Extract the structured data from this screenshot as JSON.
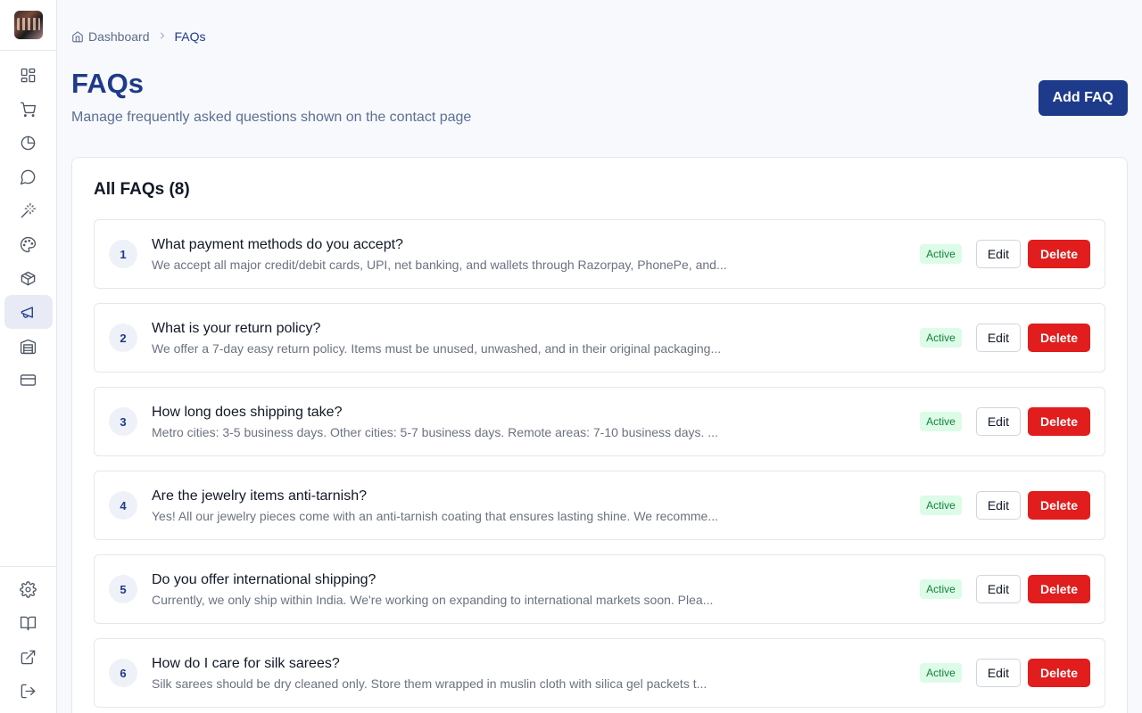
{
  "sidebar": {
    "logo": "brand-logo",
    "nav": [
      {
        "icon": "dashboard-icon"
      },
      {
        "icon": "cart-icon"
      },
      {
        "icon": "pie-chart-icon"
      },
      {
        "icon": "message-icon"
      },
      {
        "icon": "magic-wand-icon"
      },
      {
        "icon": "palette-icon"
      },
      {
        "icon": "package-icon"
      },
      {
        "icon": "megaphone-icon",
        "active": true
      },
      {
        "icon": "warehouse-icon"
      },
      {
        "icon": "credit-card-icon"
      }
    ],
    "bottom": [
      {
        "icon": "settings-icon"
      },
      {
        "icon": "book-icon"
      },
      {
        "icon": "external-link-icon"
      },
      {
        "icon": "logout-icon"
      }
    ]
  },
  "breadcrumb": {
    "home": "Dashboard",
    "current": "FAQs"
  },
  "header": {
    "title": "FAQs",
    "subtitle": "Manage frequently asked questions shown on the contact page",
    "add_button": "Add FAQ"
  },
  "list": {
    "title": "All FAQs (8)",
    "items": [
      {
        "num": "1",
        "question": "What payment methods do you accept?",
        "answer": "We accept all major credit/debit cards, UPI, net banking, and wallets through Razorpay, PhonePe, and...",
        "status": "Active",
        "edit": "Edit",
        "delete": "Delete"
      },
      {
        "num": "2",
        "question": "What is your return policy?",
        "answer": "We offer a 7-day easy return policy. Items must be unused, unwashed, and in their original packaging...",
        "status": "Active",
        "edit": "Edit",
        "delete": "Delete"
      },
      {
        "num": "3",
        "question": "How long does shipping take?",
        "answer": "Metro cities: 3-5 business days. Other cities: 5-7 business days. Remote areas: 7-10 business days. ...",
        "status": "Active",
        "edit": "Edit",
        "delete": "Delete"
      },
      {
        "num": "4",
        "question": "Are the jewelry items anti-tarnish?",
        "answer": "Yes! All our jewelry pieces come with an anti-tarnish coating that ensures lasting shine. We recomme...",
        "status": "Active",
        "edit": "Edit",
        "delete": "Delete"
      },
      {
        "num": "5",
        "question": "Do you offer international shipping?",
        "answer": "Currently, we only ship within India. We're working on expanding to international markets soon. Plea...",
        "status": "Active",
        "edit": "Edit",
        "delete": "Delete"
      },
      {
        "num": "6",
        "question": "How do I care for silk sarees?",
        "answer": "Silk sarees should be dry cleaned only. Store them wrapped in muslin cloth with silica gel packets t...",
        "status": "Active",
        "edit": "Edit",
        "delete": "Delete"
      }
    ]
  },
  "colors": {
    "primary": "#1e3a8a",
    "danger": "#e11d1d",
    "success_bg": "#dcfce7",
    "success_text": "#15803d"
  }
}
